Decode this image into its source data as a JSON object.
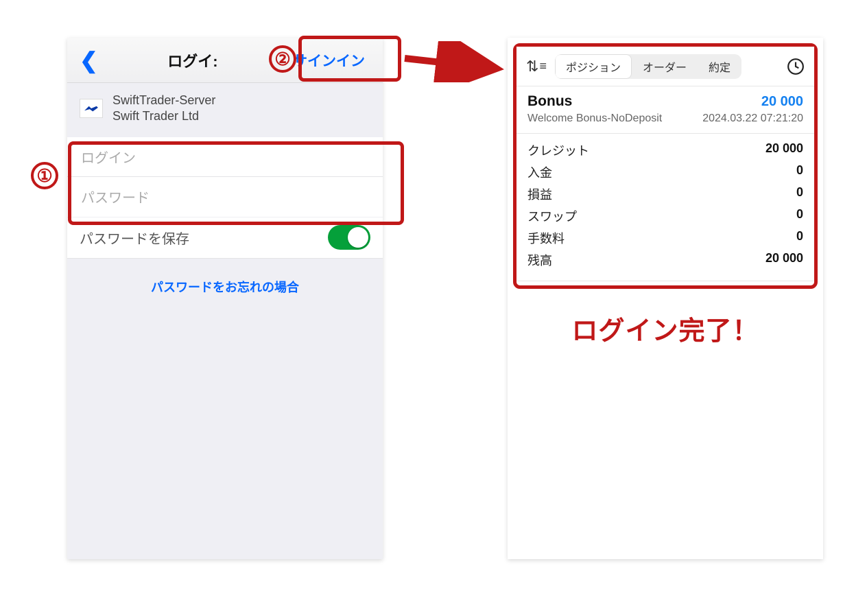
{
  "left": {
    "nav_title": "ログイ:",
    "sign_in": "サインイン",
    "server_name": "SwiftTrader-Server",
    "server_company": "Swift Trader Ltd",
    "login_placeholder": "ログイン",
    "password_placeholder": "パスワード",
    "save_password": "パスワードを保存",
    "forgot": "パスワードをお忘れの場合"
  },
  "right": {
    "tabs": {
      "positions": "ポジション",
      "orders": "オーダー",
      "deals": "約定"
    },
    "bonus": {
      "title": "Bonus",
      "amount": "20 000",
      "subtitle": "Welcome Bonus-NoDeposit",
      "timestamp": "2024.03.22 07:21:20"
    },
    "stats": {
      "credit_label": "クレジット",
      "credit_val": "20 000",
      "deposit_label": "入金",
      "deposit_val": "0",
      "pl_label": "損益",
      "pl_val": "0",
      "swap_label": "スワップ",
      "swap_val": "0",
      "commission_label": "手数料",
      "commission_val": "0",
      "balance_label": "残高",
      "balance_val": "20 000"
    },
    "complete": "ログイン完了！"
  },
  "callouts": {
    "one": "①",
    "two": "②"
  }
}
